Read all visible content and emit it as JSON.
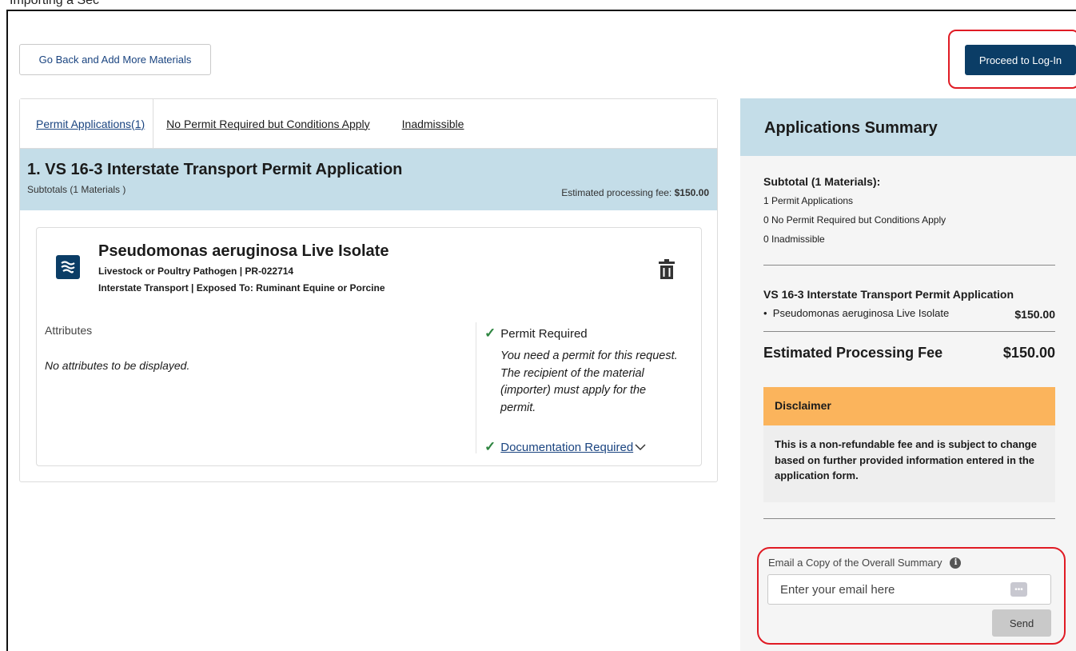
{
  "header": {
    "caption": "Importing a Sec",
    "back_button": "Go Back and Add More Materials",
    "login_button": "Proceed to Log-In"
  },
  "tabs": [
    {
      "label": "Permit Applications(1)",
      "active": true
    },
    {
      "label": "No Permit Required but Conditions Apply",
      "active": false
    },
    {
      "label": "Inadmissible",
      "active": false
    }
  ],
  "application": {
    "title": "1. VS 16-3 Interstate Transport Permit Application",
    "subtotals": "Subtotals (1 Materials )",
    "fee_label": "Estimated processing fee:",
    "fee_value": "$150.00"
  },
  "material": {
    "name": "Pseudomonas aeruginosa Live Isolate",
    "line1": "Livestock or Poultry Pathogen | PR-022714",
    "line2": "Interstate Transport | Exposed To: Ruminant Equine or Porcine",
    "icon": "waves-icon",
    "attributes_label": "Attributes",
    "attributes_empty": "No attributes to be displayed.",
    "permit_required": "Permit Required",
    "permit_desc": "You need a permit for this request. The recipient of the material (importer) must apply for the permit.",
    "documentation_required": "Documentation Required"
  },
  "summary": {
    "title": "Applications Summary",
    "subtotal": "Subtotal (1 Materials):",
    "lines": [
      "1 Permit Applications",
      "0 No Permit Required but Conditions Apply",
      "0 Inadmissible"
    ],
    "app_name": "VS 16-3 Interstate Transport Permit Application",
    "item_name": "Pseudomonas aeruginosa Live Isolate",
    "item_price": "$150.00",
    "fee_label": "Estimated Processing Fee",
    "fee_value": "$150.00"
  },
  "disclaimer": {
    "title": "Disclaimer",
    "body": "This is a non-refundable fee and is subject to change based on further provided information entered in the application form."
  },
  "email": {
    "label": "Email a Copy of the Overall Summary",
    "placeholder": "Enter your email here",
    "send_button": "Send"
  },
  "colors": {
    "brand_navy": "#0b3d66",
    "header_blue": "#c4dde8",
    "disclaimer_orange": "#fbb45c",
    "highlight_red": "#e01b24",
    "check_green": "#2e8540"
  }
}
